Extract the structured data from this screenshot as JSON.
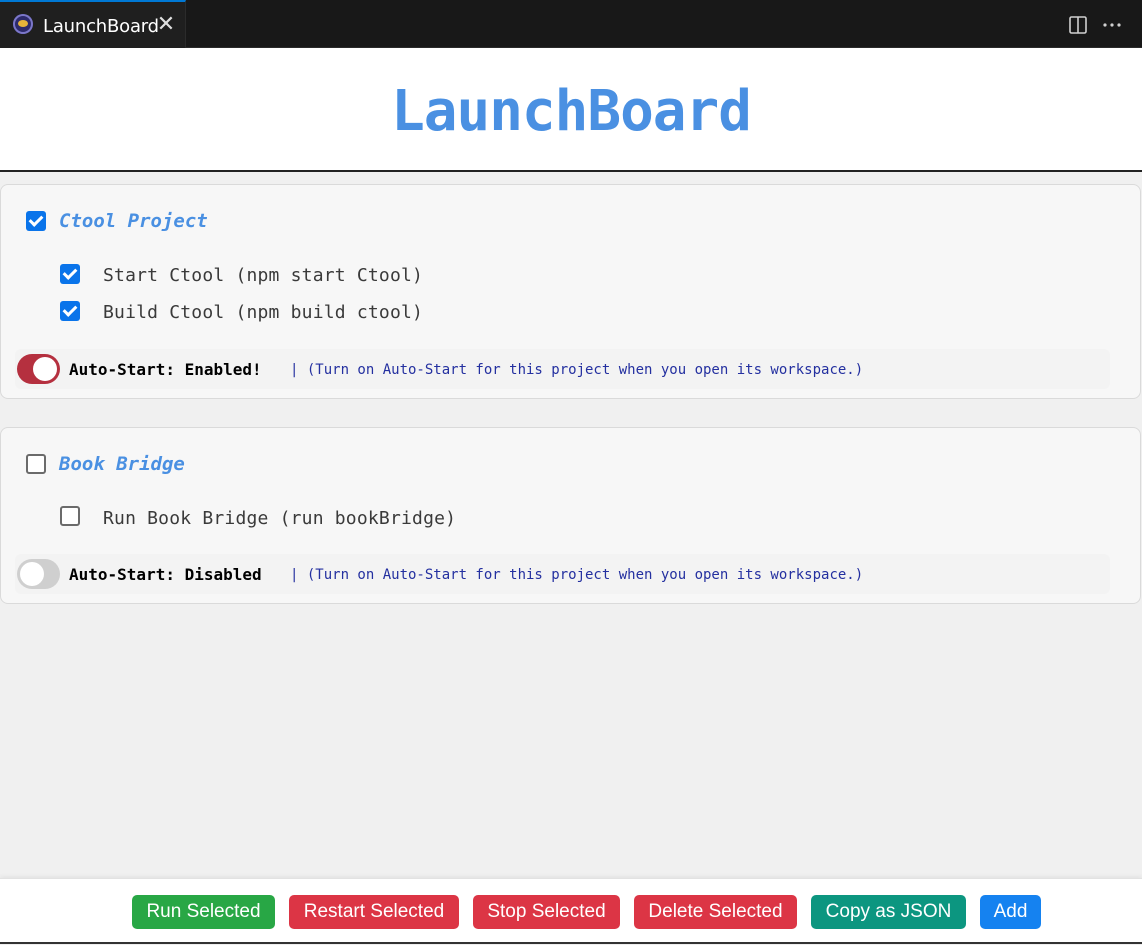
{
  "tab": {
    "title": "LaunchBoard",
    "close": "✕"
  },
  "header": {
    "title": "LaunchBoard"
  },
  "projects": [
    {
      "name": "Ctool Project",
      "checked": true,
      "commands": [
        {
          "label": "Start Ctool (npm start Ctool)",
          "checked": true
        },
        {
          "label": "Build Ctool (npm build ctool)",
          "checked": true
        }
      ],
      "auto_start": {
        "enabled": true,
        "label": "Auto-Start: Enabled!",
        "hint": "| (Turn on Auto-Start for this project when you open its workspace.)"
      }
    },
    {
      "name": "Book Bridge",
      "checked": false,
      "commands": [
        {
          "label": "Run Book Bridge (run bookBridge)",
          "checked": false
        }
      ],
      "auto_start": {
        "enabled": false,
        "label": "Auto-Start: Disabled",
        "hint": "| (Turn on Auto-Start for this project when you open its workspace.)"
      }
    }
  ],
  "footer": {
    "run": "Run Selected",
    "restart": "Restart Selected",
    "stop": "Stop Selected",
    "delete": "Delete Selected",
    "copy": "Copy as JSON",
    "add": "Add"
  },
  "icons": {
    "tab": "launchboard-extension-icon",
    "split": "split-editor-icon",
    "more": "more-actions-icon"
  },
  "colors": {
    "accent": "#4a90e2",
    "run": "#28a745",
    "danger": "#dc3545",
    "copy": "#0c9680",
    "add": "#1582f0",
    "toggle_on": "#b5303f"
  }
}
